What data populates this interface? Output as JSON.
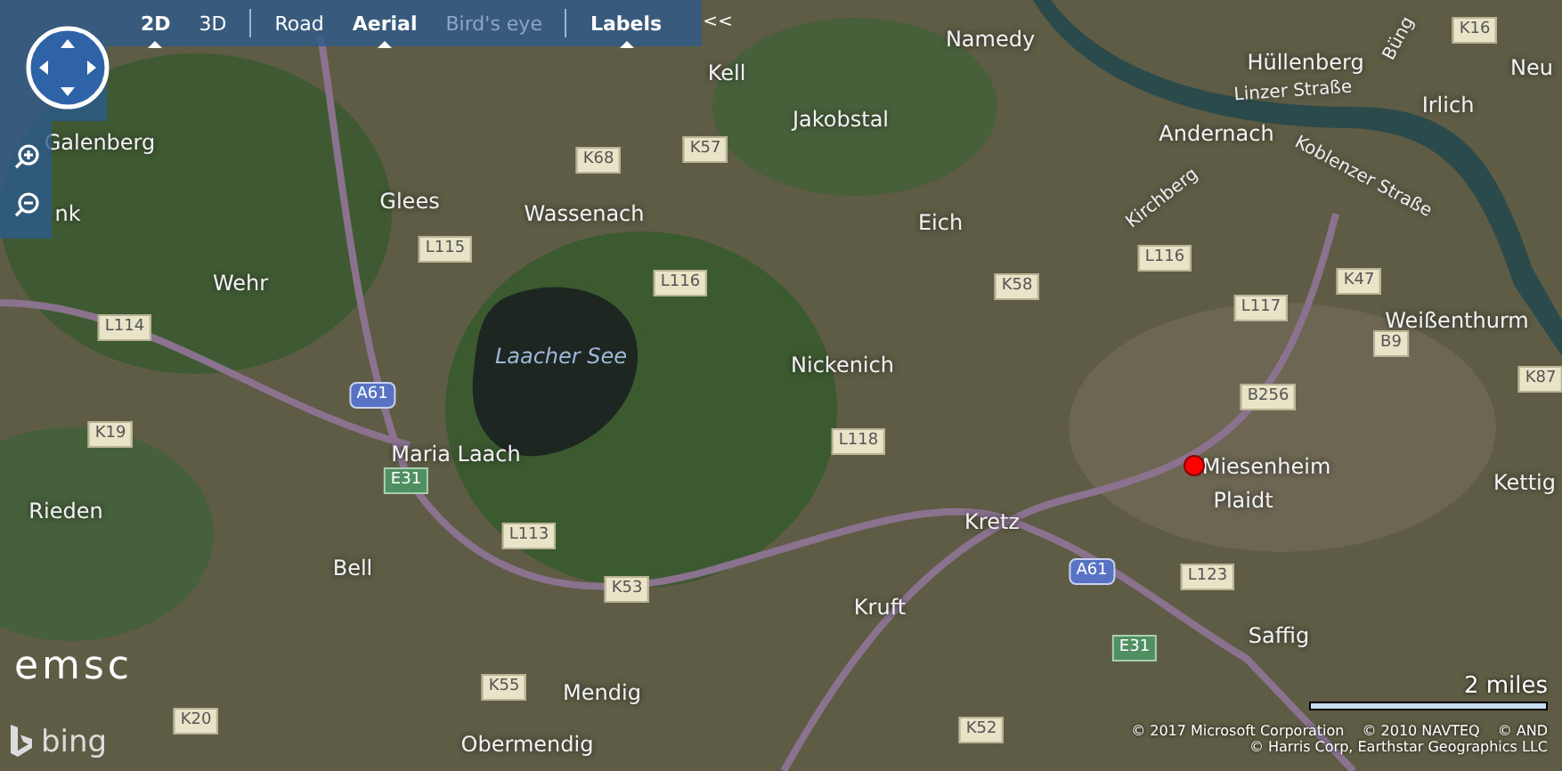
{
  "toolbar": {
    "groups": [
      [
        {
          "label": "2D",
          "selected": true,
          "disabled": false
        },
        {
          "label": "3D",
          "selected": false,
          "disabled": false
        }
      ],
      [
        {
          "label": "Road",
          "selected": false,
          "disabled": false
        },
        {
          "label": "Aerial",
          "selected": true,
          "disabled": false
        },
        {
          "label": "Bird's eye",
          "selected": false,
          "disabled": true
        }
      ],
      [
        {
          "label": "Labels",
          "selected": true,
          "disabled": false
        }
      ]
    ],
    "collapse": "<<"
  },
  "map": {
    "places": [
      {
        "name": "Galenberg",
        "kind": "place"
      },
      {
        "name": "nk",
        "kind": "place"
      },
      {
        "name": "Glees",
        "kind": "place"
      },
      {
        "name": "Wassenach",
        "kind": "place"
      },
      {
        "name": "Kell",
        "kind": "place"
      },
      {
        "name": "Jakobstal",
        "kind": "place"
      },
      {
        "name": "Namedy",
        "kind": "place"
      },
      {
        "name": "Hüllenberg",
        "kind": "place"
      },
      {
        "name": "Büng",
        "kind": "street"
      },
      {
        "name": "Linzer Straße",
        "kind": "street"
      },
      {
        "name": "Irlich",
        "kind": "place"
      },
      {
        "name": "Neu",
        "kind": "place"
      },
      {
        "name": "Andernach",
        "kind": "place"
      },
      {
        "name": "Kirchberg",
        "kind": "street"
      },
      {
        "name": "Koblenzer Straße",
        "kind": "street"
      },
      {
        "name": "Eich",
        "kind": "place"
      },
      {
        "name": "Wehr",
        "kind": "place"
      },
      {
        "name": "Laacher See",
        "kind": "water"
      },
      {
        "name": "Nickenich",
        "kind": "place"
      },
      {
        "name": "Weißenthurm",
        "kind": "place"
      },
      {
        "name": "Maria Laach",
        "kind": "place"
      },
      {
        "name": "Miesenheim",
        "kind": "place"
      },
      {
        "name": "Plaidt",
        "kind": "place"
      },
      {
        "name": "Kettig",
        "kind": "place"
      },
      {
        "name": "Rieden",
        "kind": "place"
      },
      {
        "name": "Kretz",
        "kind": "place"
      },
      {
        "name": "Bell",
        "kind": "place"
      },
      {
        "name": "Kruft",
        "kind": "place"
      },
      {
        "name": "Saffig",
        "kind": "place"
      },
      {
        "name": "Mendig",
        "kind": "place"
      },
      {
        "name": "Obermendig",
        "kind": "place"
      }
    ],
    "shields": [
      {
        "label": "K16",
        "kind": "regional"
      },
      {
        "label": "K68",
        "kind": "regional"
      },
      {
        "label": "K57",
        "kind": "regional"
      },
      {
        "label": "L115",
        "kind": "regional"
      },
      {
        "label": "L116",
        "kind": "regional"
      },
      {
        "label": "L116",
        "kind": "regional"
      },
      {
        "label": "K58",
        "kind": "regional"
      },
      {
        "label": "K47",
        "kind": "regional"
      },
      {
        "label": "L117",
        "kind": "regional"
      },
      {
        "label": "B9",
        "kind": "regional"
      },
      {
        "label": "K87",
        "kind": "regional"
      },
      {
        "label": "L114",
        "kind": "regional"
      },
      {
        "label": "A61",
        "kind": "motorway"
      },
      {
        "label": "B256",
        "kind": "regional"
      },
      {
        "label": "K19",
        "kind": "regional"
      },
      {
        "label": "L118",
        "kind": "regional"
      },
      {
        "label": "E31",
        "kind": "european"
      },
      {
        "label": "L113",
        "kind": "regional"
      },
      {
        "label": "K53",
        "kind": "regional"
      },
      {
        "label": "A61",
        "kind": "motorway"
      },
      {
        "label": "L123",
        "kind": "regional"
      },
      {
        "label": "E31",
        "kind": "european"
      },
      {
        "label": "K55",
        "kind": "regional"
      },
      {
        "label": "K20",
        "kind": "regional"
      },
      {
        "label": "K52",
        "kind": "regional"
      }
    ]
  },
  "logo": "emsc",
  "provider": "bing",
  "scale": "2 miles",
  "copyright": {
    "line_1": [
      "© 2017 Microsoft Corporation",
      "© 2010 NAVTEQ",
      "© AND"
    ],
    "line_2": "© Harris Corp, Earthstar Geographics LLC"
  }
}
